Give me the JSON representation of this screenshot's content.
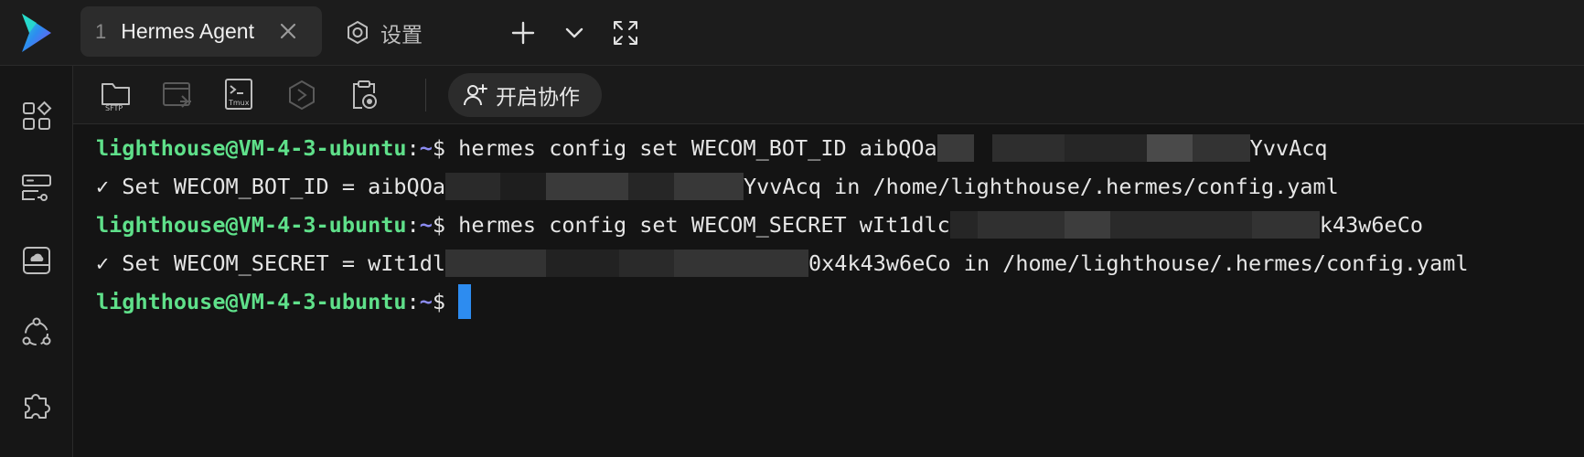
{
  "tabs": [
    {
      "number": "1",
      "title": "Hermes Agent",
      "active": true
    },
    {
      "title": "设置",
      "icon": "gear-icon"
    }
  ],
  "top_actions": [
    {
      "icon": "plus-icon"
    },
    {
      "icon": "chevron-down-icon"
    },
    {
      "icon": "fullscreen-icon"
    }
  ],
  "sidebar": {
    "items": [
      {
        "icon": "apps-grid-icon"
      },
      {
        "icon": "server-list-icon"
      },
      {
        "icon": "cloud-drive-icon"
      },
      {
        "icon": "share-nodes-icon"
      },
      {
        "icon": "puzzle-icon"
      }
    ]
  },
  "toolbar": {
    "sftp_label": "SFTP",
    "tmux_label": "Tmux",
    "collab_label": "开启协作"
  },
  "terminal": {
    "prompt_user": "lighthouse@VM-4-3-ubuntu",
    "prompt_sep": ":",
    "prompt_path": "~",
    "prompt_dollar": "$",
    "lines": [
      {
        "cmd_pre": " hermes config set WECOM_BOT_ID aibQOa",
        "cmd_post": "YvvAcq"
      },
      {
        "out_pre": "✓ Set WECOM_BOT_ID = aibQOa",
        "out_post": "YvvAcq in /home/lighthouse/.hermes/config.yaml"
      },
      {
        "cmd_pre": " hermes config set WECOM_SECRET wIt1dlc",
        "cmd_post": "k43w6eCo"
      },
      {
        "out_pre": "✓ Set WECOM_SECRET = wIt1dl",
        "out_post": "0x4k43w6eCo in /home/lighthouse/.hermes/config.yaml"
      }
    ]
  },
  "colors": {
    "accent_blue": "#2d8cf0",
    "prompt_green": "#5fe08a",
    "prompt_path": "#8c8cf2",
    "background": "#141414"
  }
}
